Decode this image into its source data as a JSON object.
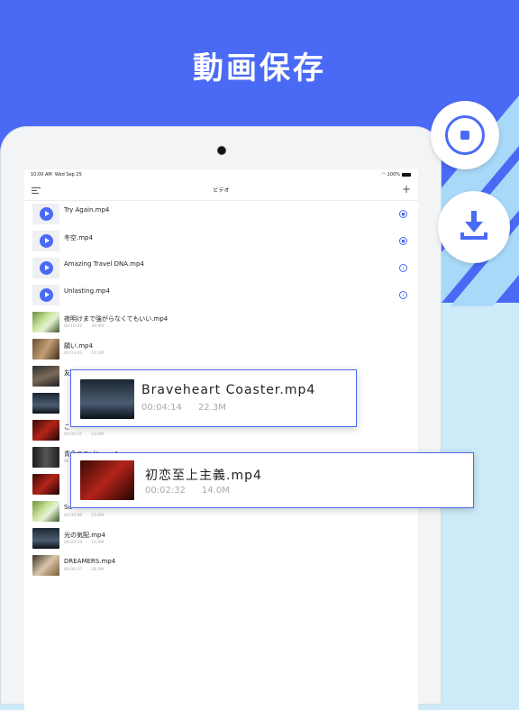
{
  "headline": "動画保存",
  "colors": {
    "brand": "#4a6af5",
    "background_light": "#cdeaf9"
  },
  "status_bar": {
    "time": "10:00 AM",
    "date": "Wed Sep 25",
    "battery": "100%"
  },
  "navbar": {
    "title": "ビデオ",
    "menu_icon": "menu-icon",
    "add_icon": "plus-icon",
    "add_symbol": "+"
  },
  "audio_items": [
    {
      "name": "Try Again.mp4",
      "icon": "loading-icon"
    },
    {
      "name": "冬空.mp4",
      "icon": "loading-icon"
    },
    {
      "name": "Amazing Travel DNA.mp4",
      "icon": "download-icon"
    },
    {
      "name": "Unlasting.mp4",
      "icon": "download-icon"
    }
  ],
  "video_items": [
    {
      "name": "夜明けまで強がらなくてもいい.mp4",
      "duration": "00:10:02",
      "size": "30.8M",
      "thumb": "green"
    },
    {
      "name": "願い.mp4",
      "duration": "00:03:02",
      "size": "10.5M",
      "thumb": "brown"
    },
    {
      "name": "友よ.mp4",
      "duration": "",
      "size": "",
      "thumb": "dark"
    },
    {
      "name": "",
      "duration": "",
      "size": "",
      "thumb": "night"
    },
    {
      "name": "こ",
      "duration": "00:06:35",
      "size": "23.6M",
      "thumb": "red"
    },
    {
      "name": "青色ユニゾン.mp4",
      "duration": "00",
      "size": "",
      "thumb": "mono"
    },
    {
      "name": "",
      "duration": "",
      "size": "",
      "thumb": "red"
    },
    {
      "name": "Su",
      "duration": "00:00:00",
      "size": "10.6M",
      "thumb": "green"
    },
    {
      "name": "光の気配.mp4",
      "duration": "00:03:34",
      "size": "10.9M",
      "thumb": "night"
    },
    {
      "name": "DREAMERS.mp4",
      "duration": "00:06:37",
      "size": "28.3M",
      "thumb": "tan"
    }
  ],
  "callouts": [
    {
      "name": "Braveheart Coaster.mp4",
      "duration": "00:04:14",
      "size": "22.3M",
      "thumb": "night"
    },
    {
      "name": "初恋至上主義.mp4",
      "duration": "00:02:32",
      "size": "14.0M",
      "thumb": "red"
    }
  ],
  "bubbles": {
    "stop": "stop-icon",
    "download": "download-icon"
  }
}
